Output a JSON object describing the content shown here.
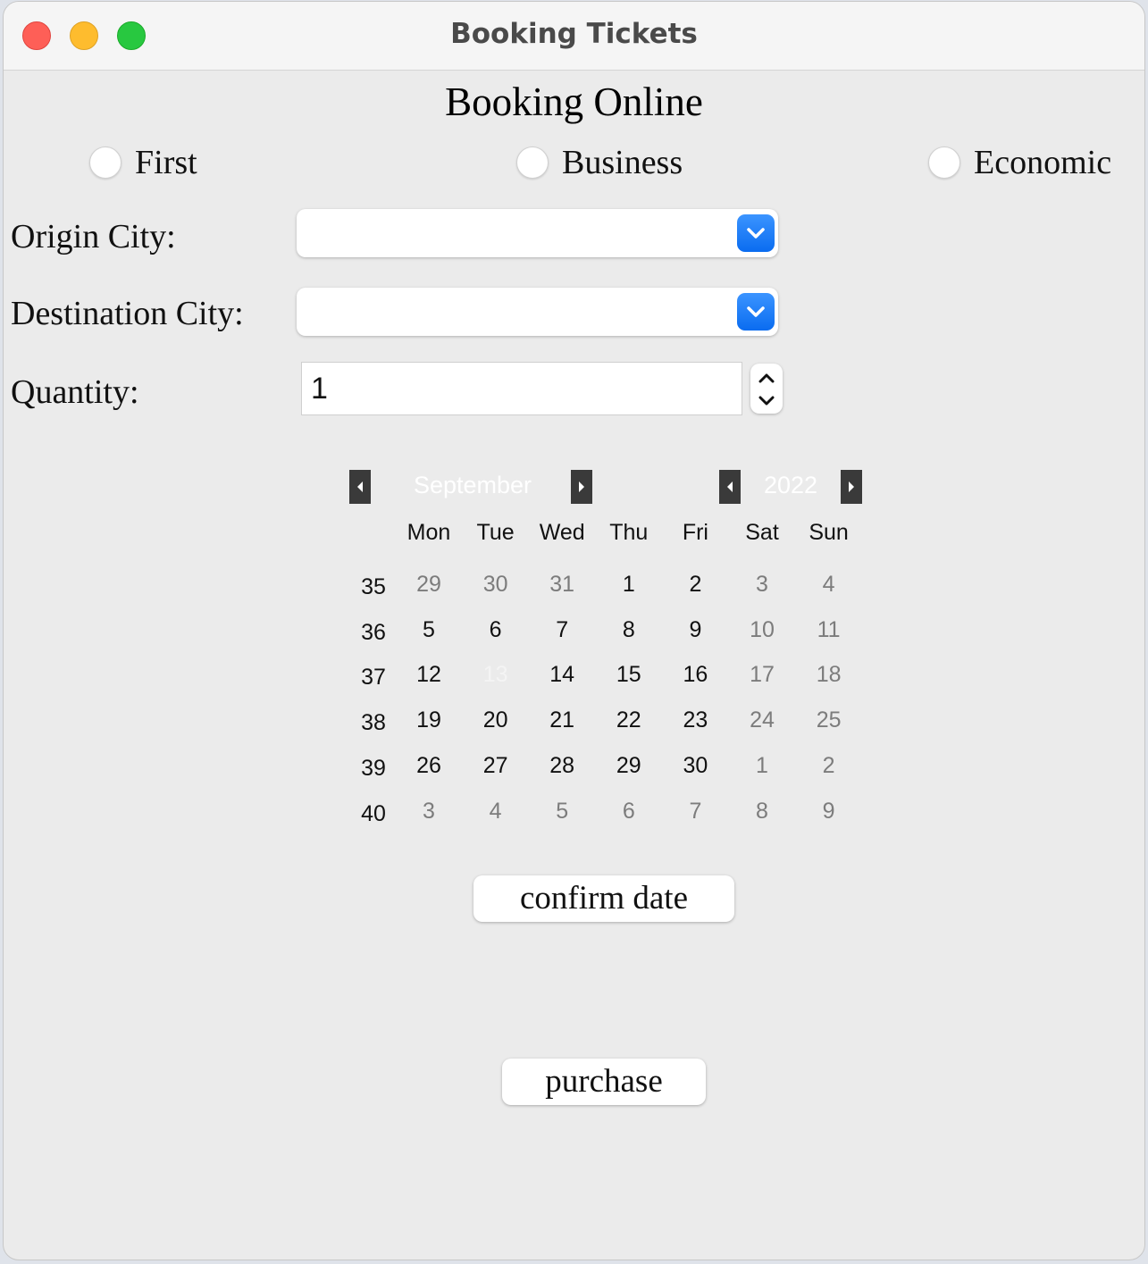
{
  "window": {
    "title": "Booking Tickets"
  },
  "heading": "Booking Online",
  "seat_classes": [
    {
      "label": "First",
      "selected": false
    },
    {
      "label": "Business",
      "selected": false
    },
    {
      "label": "Economic",
      "selected": false
    }
  ],
  "form": {
    "origin_label": "Origin City:",
    "origin_value": "",
    "destination_label": "Destination City:",
    "destination_value": "",
    "quantity_label": "Quantity:",
    "quantity_value": "1"
  },
  "calendar": {
    "month": "September",
    "year": "2022",
    "weekdays": [
      "Mon",
      "Tue",
      "Wed",
      "Thu",
      "Fri",
      "Sat",
      "Sun"
    ],
    "selected_day": "13",
    "weeks": [
      {
        "num": "35",
        "days": [
          "29",
          "30",
          "31",
          "1",
          "2",
          "3",
          "4"
        ],
        "other_month": [
          true,
          true,
          true,
          false,
          false,
          false,
          false
        ]
      },
      {
        "num": "36",
        "days": [
          "5",
          "6",
          "7",
          "8",
          "9",
          "10",
          "11"
        ],
        "other_month": [
          false,
          false,
          false,
          false,
          false,
          false,
          false
        ]
      },
      {
        "num": "37",
        "days": [
          "12",
          "13",
          "14",
          "15",
          "16",
          "17",
          "18"
        ],
        "other_month": [
          false,
          false,
          false,
          false,
          false,
          false,
          false
        ]
      },
      {
        "num": "38",
        "days": [
          "19",
          "20",
          "21",
          "22",
          "23",
          "24",
          "25"
        ],
        "other_month": [
          false,
          false,
          false,
          false,
          false,
          false,
          false
        ]
      },
      {
        "num": "39",
        "days": [
          "26",
          "27",
          "28",
          "29",
          "30",
          "1",
          "2"
        ],
        "other_month": [
          false,
          false,
          false,
          false,
          false,
          true,
          true
        ]
      },
      {
        "num": "40",
        "days": [
          "3",
          "4",
          "5",
          "6",
          "7",
          "8",
          "9"
        ],
        "other_month": [
          true,
          true,
          true,
          true,
          true,
          true,
          true
        ]
      }
    ]
  },
  "buttons": {
    "confirm_date": "confirm date",
    "purchase": "purchase"
  },
  "colors": {
    "window_bg": "#ebebeb",
    "accent": "#0a6cf0",
    "nav_button": "#3a3a3a",
    "muted_day": "#7c7c7c"
  }
}
